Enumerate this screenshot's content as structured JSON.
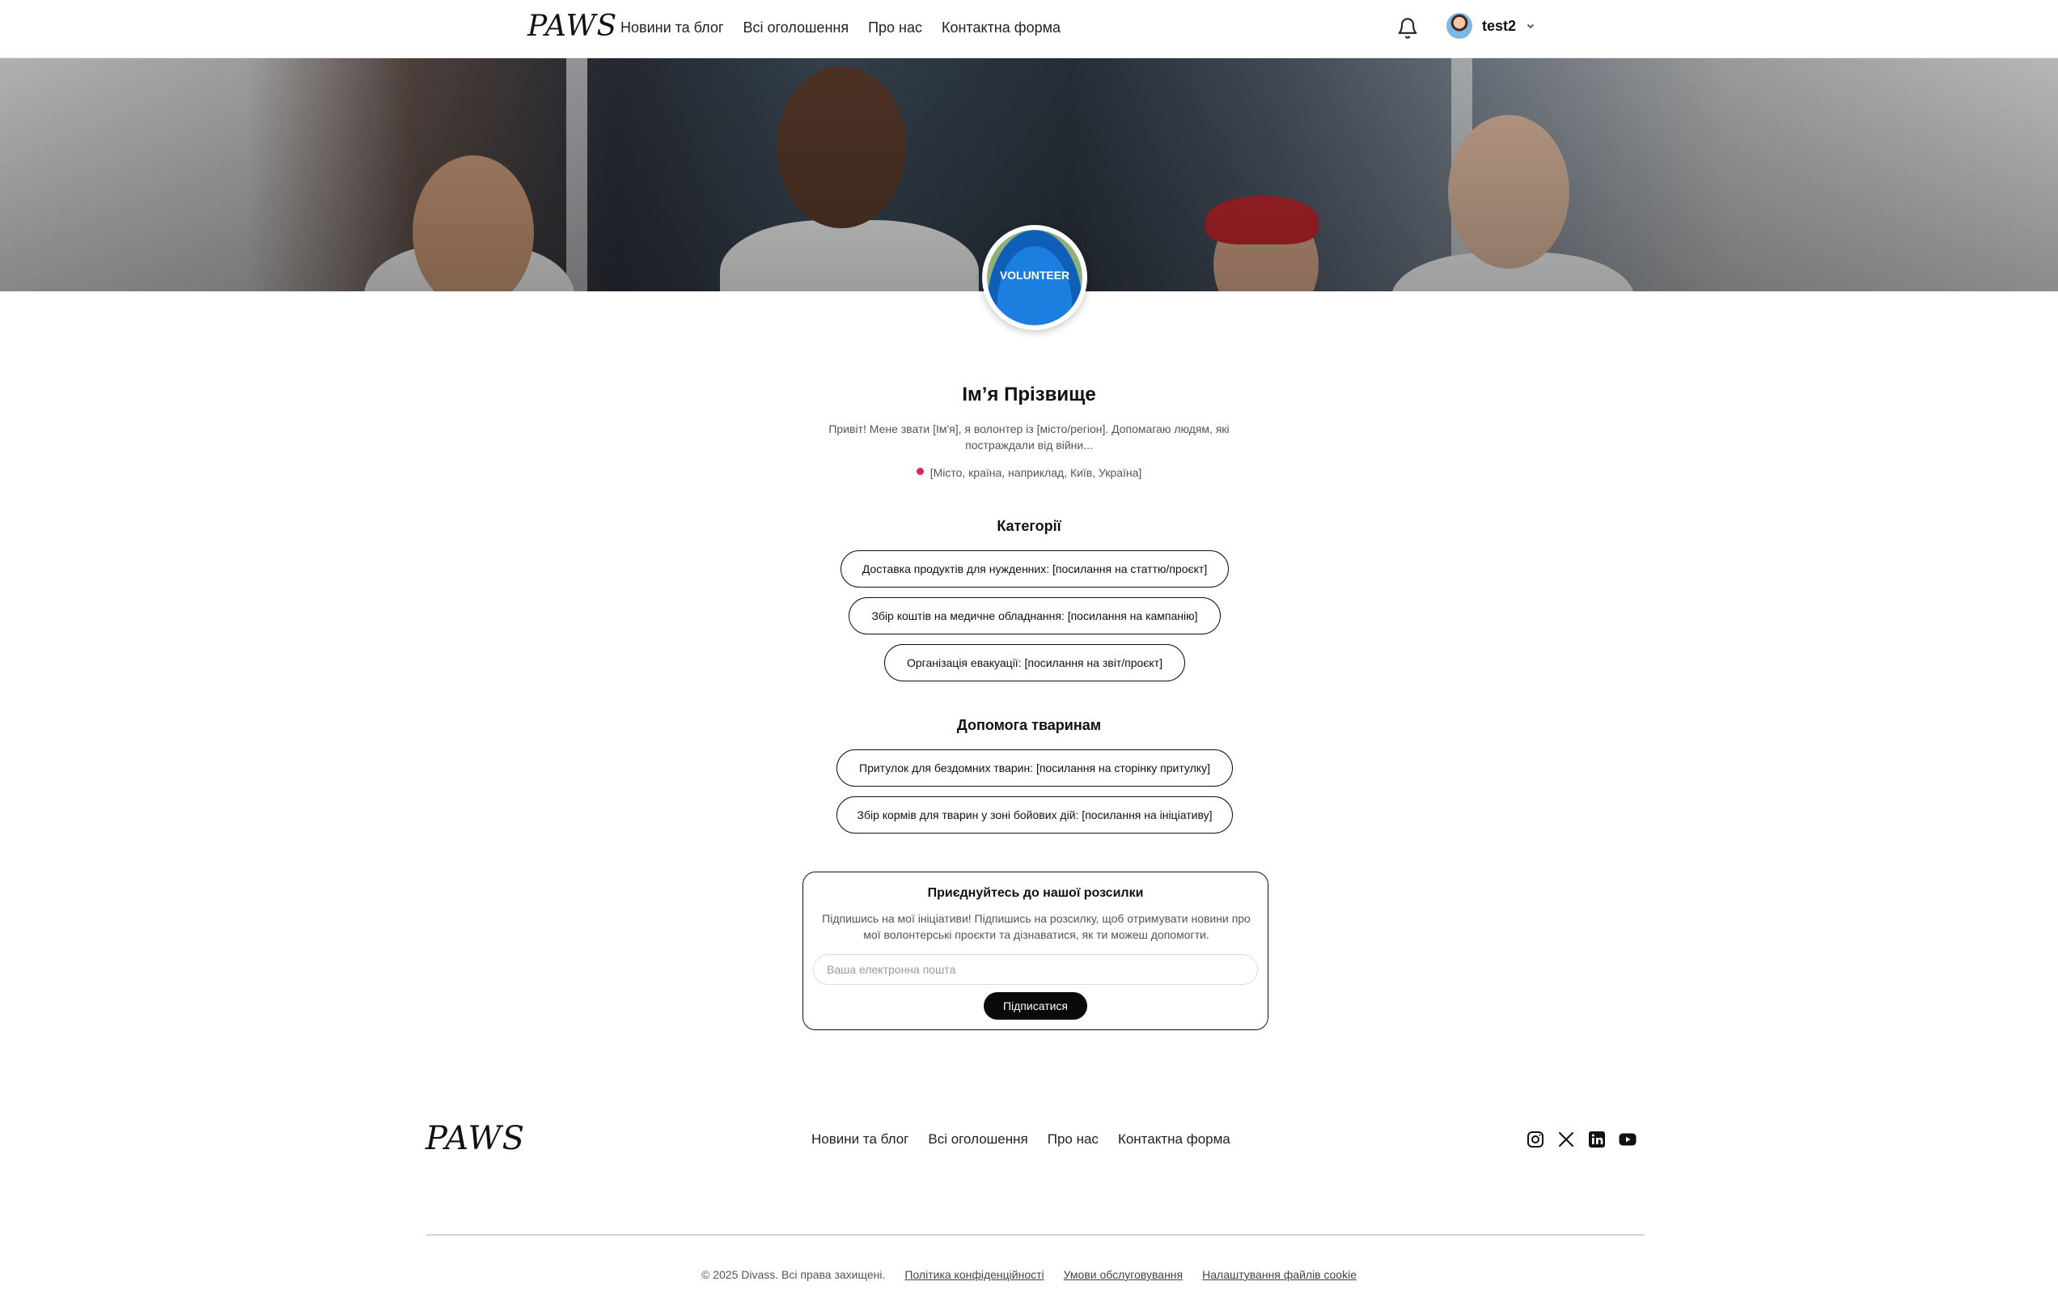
{
  "header": {
    "logo": "PAWS",
    "nav": [
      "Новини та блог",
      "Всі оголошення",
      "Про нас",
      "Контактна форма"
    ],
    "username": "test2"
  },
  "hero": {
    "badge_text": "VOLUNTEER"
  },
  "profile": {
    "name": "Ім’я Прізвище",
    "bio": "Привіт! Мене звати [Ім'я], я волонтер із [місто/регіон]. Допомагаю людям, які постраждали від війни...",
    "location": "[Місто, країна, наприклад, Київ, Україна]"
  },
  "categories": {
    "title": "Категорії",
    "items": [
      "Доставка продуктів для нужденних: [посилання на статтю/проєкт]",
      "Збір коштів на медичне обладнання: [посилання на кампанію]",
      "Організація евакуації: [посилання на звіт/проєкт]"
    ]
  },
  "animals": {
    "title": "Допомога тваринам",
    "items": [
      "Притулок для бездомних тварин: [посилання на сторінку притулку]",
      "Збір кормів для тварин у зоні бойових дій: [посилання на ініціативу]"
    ]
  },
  "newsletter": {
    "title": "Приєднуйтесь до нашої розсилки",
    "text": "Підпишись на мої ініціативи! Підпишись на розсилку, щоб отримувати новини про мої волонтерські проєкти та дізнаватися, як ти можеш допомогти.",
    "placeholder": "Ваша електронна пошта",
    "button": "Підписатися"
  },
  "footer": {
    "logo": "PAWS",
    "nav": [
      "Новини та блог",
      "Всі оголошення",
      "Про нас",
      "Контактна форма"
    ],
    "socials": [
      "instagram-icon",
      "x-icon",
      "linkedin-icon",
      "youtube-icon"
    ],
    "copyright": "© 2025 Divass. Всі права захищені.",
    "links": [
      "Політика конфіденційності",
      "Умови обслуговування",
      "Налаштування файлів cookie"
    ]
  },
  "colors": {
    "accent": "#0a0a0a",
    "location_pin": "#e0245e"
  }
}
